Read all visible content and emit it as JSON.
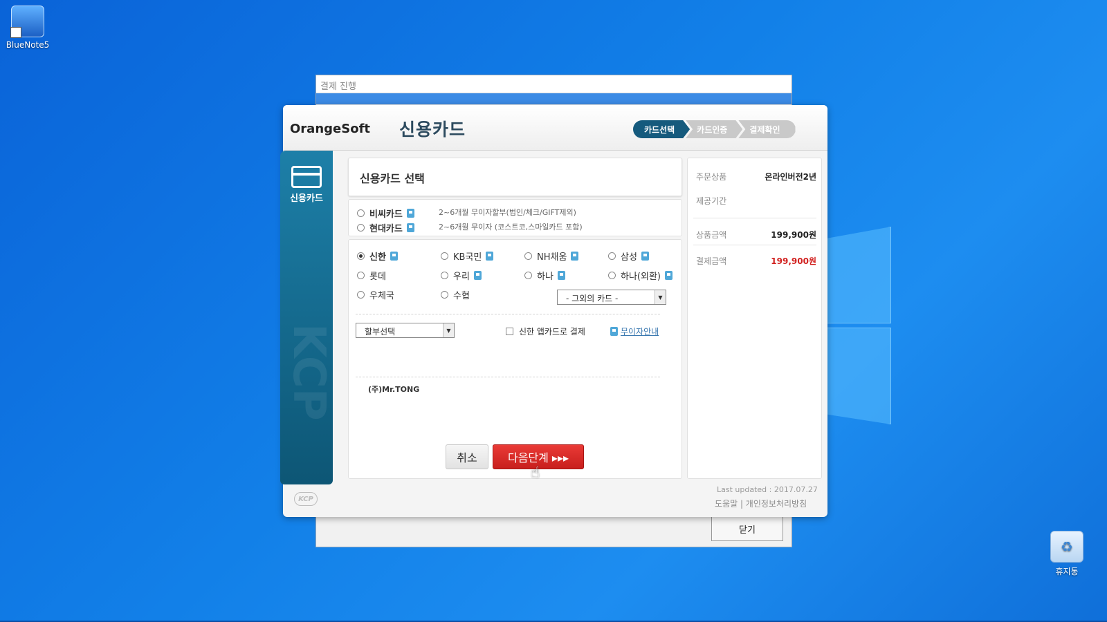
{
  "desktop": {
    "icons": [
      {
        "label": "BlueNote5"
      },
      {
        "label": "휴지통"
      }
    ]
  },
  "bg_window": {
    "title": "결제 진행",
    "close_label": "닫기"
  },
  "dialog": {
    "brand": "OrangeSoft",
    "title": "신용카드",
    "steps": [
      "카드선택",
      "카드인증",
      "결제확인"
    ],
    "sidebar_label": "신용카드",
    "panel_title": "신용카드 선택",
    "special_cards": [
      {
        "name": "비씨카드",
        "desc": "2~6개월 무이자할부(법인/체크/GIFT제외)"
      },
      {
        "name": "현대카드",
        "desc": "2~6개월 무이자 (코스트코,스마일카드 포함)"
      }
    ],
    "cards": [
      {
        "name": "신한",
        "selected": true
      },
      {
        "name": "KB국민"
      },
      {
        "name": "NH채움"
      },
      {
        "name": "삼성"
      },
      {
        "name": "롯데"
      },
      {
        "name": "우리"
      },
      {
        "name": "하나"
      },
      {
        "name": "하나(외환)"
      },
      {
        "name": "우체국"
      },
      {
        "name": "수협"
      }
    ],
    "other_card_select": "- 그외의 카드 -",
    "installment_select": "할부선택",
    "app_card_checkbox": "신한 앱카드로 결제",
    "no_interest_link": "무이자안내",
    "merchant_logo": "(주)Mr.TONG",
    "cancel_label": "취소",
    "next_label": "다음단계 ▸▸▸",
    "summary": {
      "order_label": "주문상품",
      "order_value": "온라인버전2년",
      "period_label": "제공기간",
      "price_label": "상품금액",
      "price_value": "199,900원",
      "pay_label": "결제금액",
      "pay_value": "199,900원"
    },
    "last_updated": "Last updated : 2017.07.27",
    "help_link": "도움말",
    "privacy_link": "개인정보처리방침",
    "kcp_logo": "KCP",
    "colors": {
      "accent": "#155a7d",
      "next_button": "#d92b28",
      "pay_amount": "#d1201e"
    }
  }
}
